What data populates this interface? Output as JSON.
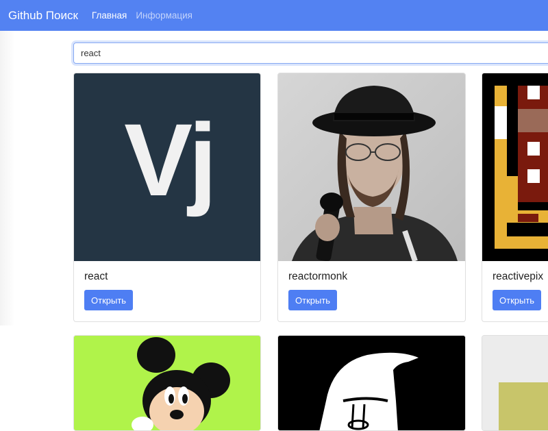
{
  "navbar": {
    "brand": "Github Поиск",
    "links": [
      {
        "label": "Главная",
        "active": true
      },
      {
        "label": "Информация",
        "active": false
      }
    ]
  },
  "search": {
    "value": "react"
  },
  "cards": [
    {
      "login": "react",
      "button_label": "Открыть",
      "avatar": "vj-logo",
      "avatar_text": "Vj"
    },
    {
      "login": "reactormonk",
      "button_label": "Открыть",
      "avatar": "person-photo"
    },
    {
      "login": "reactivepix",
      "button_label": "Открыть",
      "avatar": "pixel-art"
    },
    {
      "avatar": "mickey-mouse"
    },
    {
      "avatar": "wizard-silhouette"
    },
    {
      "avatar": "olive-square"
    }
  ],
  "colors": {
    "navbar": "#5382f2",
    "button": "#4e7ef3",
    "vj_background": "#243544",
    "green_background": "#b0f34a"
  }
}
